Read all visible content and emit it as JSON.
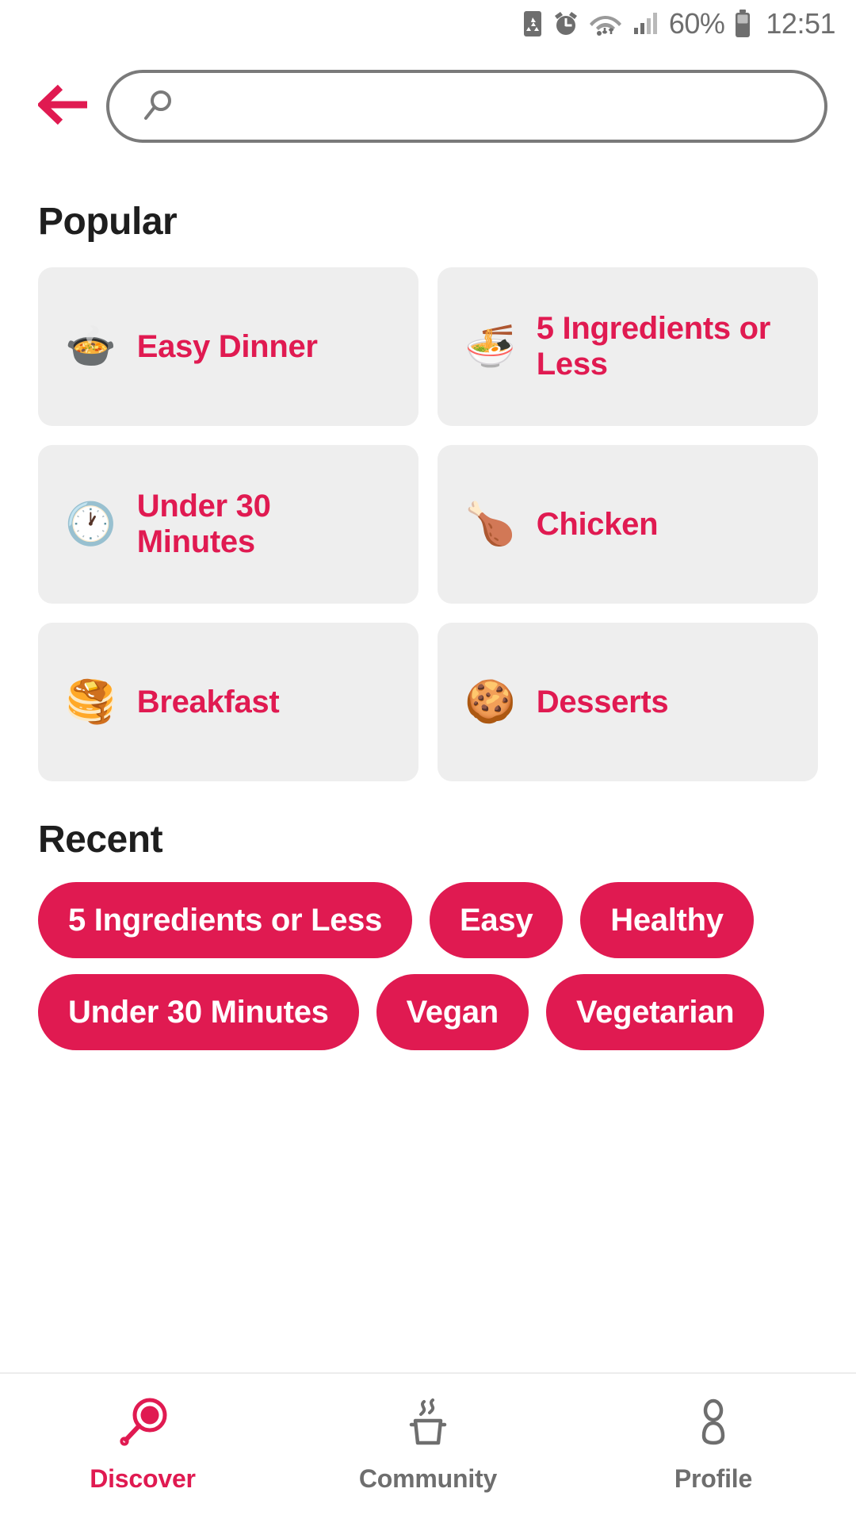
{
  "theme": {
    "accent": "#e01a51",
    "card_bg": "#eeeeee",
    "heading": "#1e1e1e",
    "muted": "#6e6e6e"
  },
  "status_bar": {
    "battery_saver_icon": "battery-saver-icon",
    "alarm_icon": "alarm-icon",
    "wifi_icon": "wifi-icon",
    "signal_icon": "cellular-signal-icon",
    "battery_percent": "60%",
    "battery_icon": "battery-icon",
    "time": "12:51"
  },
  "header": {
    "back_icon": "back-arrow-icon",
    "search": {
      "icon": "search-icon",
      "value": "",
      "placeholder": ""
    }
  },
  "popular": {
    "title": "Popular",
    "items": [
      {
        "emoji": "🍲",
        "icon_name": "pot-of-food-emoji",
        "label": "Easy Dinner"
      },
      {
        "emoji": "🍜",
        "icon_name": "steaming-noodles-emoji",
        "label": "5 Ingredients or Less"
      },
      {
        "emoji": "🕐",
        "icon_name": "clock-emoji",
        "label": "Under 30 Minutes"
      },
      {
        "emoji": "🍗",
        "icon_name": "poultry-leg-emoji",
        "label": "Chicken"
      },
      {
        "emoji": "🥞",
        "icon_name": "pancakes-emoji",
        "label": "Breakfast"
      },
      {
        "emoji": "🍪",
        "icon_name": "cookie-emoji",
        "label": "Desserts"
      }
    ]
  },
  "recent": {
    "title": "Recent",
    "chips": [
      "5 Ingredients or Less",
      "Easy",
      "Healthy",
      "Under 30 Minutes",
      "Vegan",
      "Vegetarian"
    ]
  },
  "bottom_nav": {
    "items": [
      {
        "label": "Discover",
        "icon_name": "frying-pan-icon",
        "active": true
      },
      {
        "label": "Community",
        "icon_name": "cooking-pot-icon",
        "active": false
      },
      {
        "label": "Profile",
        "icon_name": "person-icon",
        "active": false
      }
    ]
  }
}
